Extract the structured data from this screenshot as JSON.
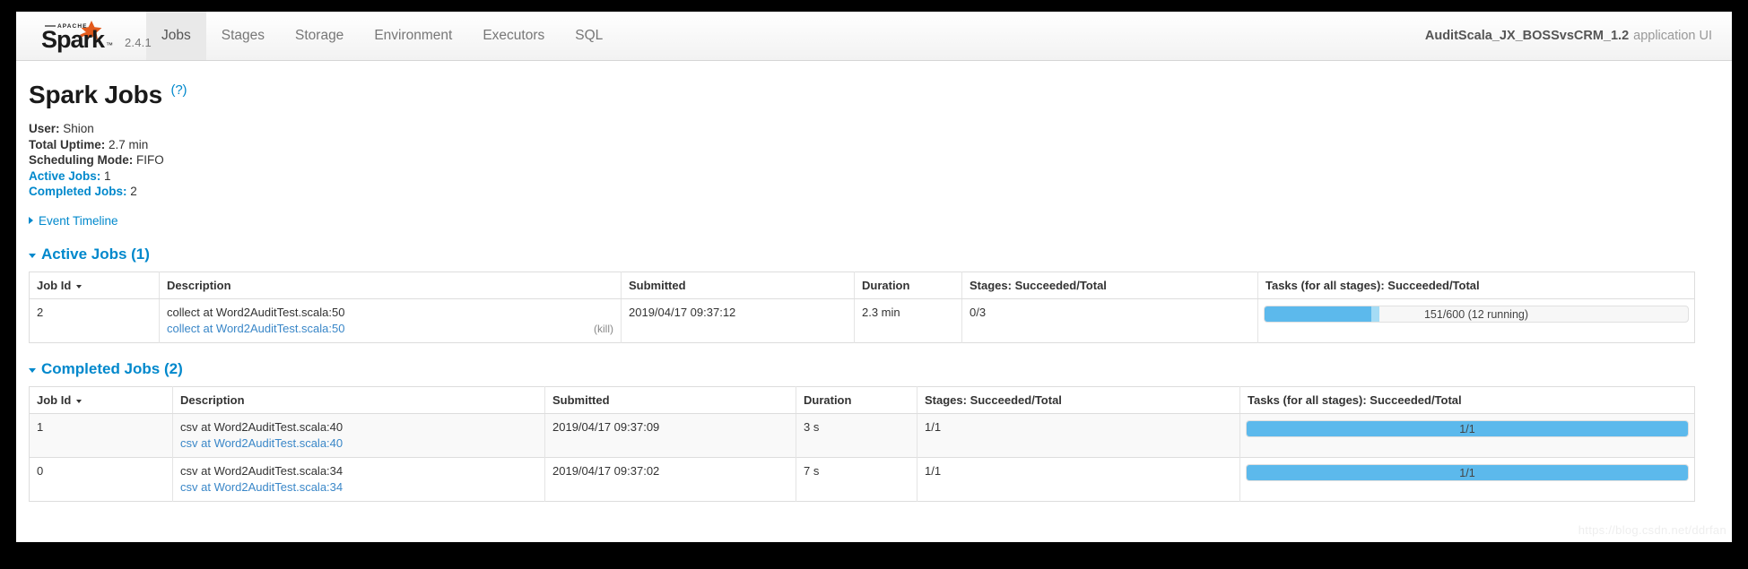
{
  "navbar": {
    "logo_alt": "Apache Spark",
    "version": "2.4.1",
    "tabs": [
      {
        "label": "Jobs",
        "active": true
      },
      {
        "label": "Stages",
        "active": false
      },
      {
        "label": "Storage",
        "active": false
      },
      {
        "label": "Environment",
        "active": false
      },
      {
        "label": "Executors",
        "active": false
      },
      {
        "label": "SQL",
        "active": false
      }
    ],
    "app_name": "AuditScala_JX_BOSSvsCRM_1.2",
    "app_suffix": "application UI"
  },
  "page": {
    "title": "Spark Jobs",
    "help_label": "(?)"
  },
  "summary": {
    "user_label": "User:",
    "user_value": "Shion",
    "uptime_label": "Total Uptime:",
    "uptime_value": "2.7 min",
    "scheduling_label": "Scheduling Mode:",
    "scheduling_value": "FIFO",
    "active_jobs_label": "Active Jobs:",
    "active_jobs_value": "1",
    "completed_jobs_label": "Completed Jobs:",
    "completed_jobs_value": "2"
  },
  "event_timeline": {
    "label": "Event Timeline"
  },
  "active_section": {
    "title": "Active Jobs (1)",
    "columns": [
      "Job Id",
      "Description",
      "Submitted",
      "Duration",
      "Stages: Succeeded/Total",
      "Tasks (for all stages): Succeeded/Total"
    ],
    "rows": [
      {
        "job_id": "2",
        "description_text": "collect at Word2AuditTest.scala:50",
        "description_link": "collect at Word2AuditTest.scala:50",
        "kill_label": "(kill)",
        "submitted": "2019/04/17 09:37:12",
        "duration": "2.3 min",
        "stages": "0/3",
        "tasks_label": "151/600 (12 running)",
        "tasks_completed_pct": 25.2,
        "tasks_running_pct": 2.0
      }
    ]
  },
  "completed_section": {
    "title": "Completed Jobs (2)",
    "columns": [
      "Job Id",
      "Description",
      "Submitted",
      "Duration",
      "Stages: Succeeded/Total",
      "Tasks (for all stages): Succeeded/Total"
    ],
    "rows": [
      {
        "job_id": "1",
        "description_text": "csv at Word2AuditTest.scala:40",
        "description_link": "csv at Word2AuditTest.scala:40",
        "submitted": "2019/04/17 09:37:09",
        "duration": "3 s",
        "stages": "1/1",
        "tasks_label": "1/1",
        "tasks_completed_pct": 100,
        "tasks_running_pct": 0
      },
      {
        "job_id": "0",
        "description_text": "csv at Word2AuditTest.scala:34",
        "description_link": "csv at Word2AuditTest.scala:34",
        "submitted": "2019/04/17 09:37:02",
        "duration": "7 s",
        "stages": "1/1",
        "tasks_label": "1/1",
        "tasks_completed_pct": 100,
        "tasks_running_pct": 0
      }
    ]
  },
  "watermark": {
    "text": "https://blog.csdn.net/ddrfan"
  },
  "colors": {
    "link": "#0088cc",
    "progress_completed": "#5cb9ec",
    "progress_running": "#a5dcf5",
    "logo_star": "#e25a1c"
  }
}
